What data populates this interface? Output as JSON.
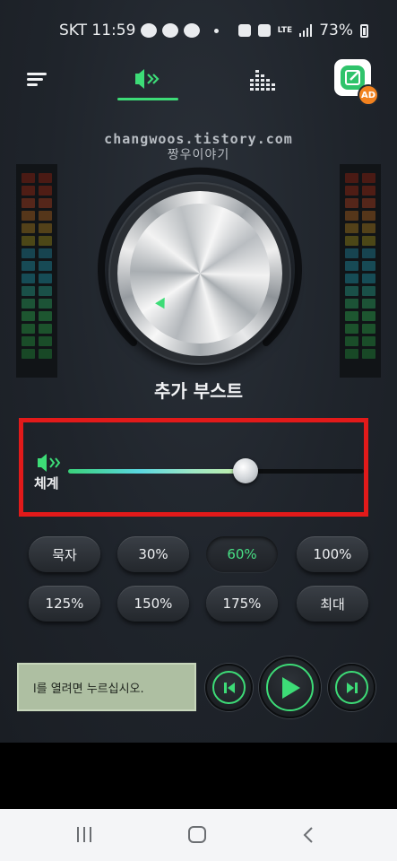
{
  "status_bar": {
    "carrier_time": "SKT 11:59",
    "lte": "LTE",
    "battery": "73%"
  },
  "nav": {
    "menu_icon": "hamburger-menu-icon",
    "volume_tab_icon": "speaker-boost-icon",
    "equalizer_tab_icon": "equalizer-bars-icon",
    "ad_badge": "AD"
  },
  "watermark": {
    "line1": "changwoos.tistory.com",
    "line2": "짱우이야기"
  },
  "knob": {
    "label": "추가 부스트",
    "indicator_icon": "triangle-indicator-icon"
  },
  "slider": {
    "label": "체계",
    "value_percent": 60,
    "accent": "#3ddc77"
  },
  "presets": [
    {
      "label": "묵자",
      "active": false
    },
    {
      "label": "30%",
      "active": false
    },
    {
      "label": "60%",
      "active": true
    },
    {
      "label": "100%",
      "active": false
    },
    {
      "label": "125%",
      "active": false
    },
    {
      "label": "150%",
      "active": false
    },
    {
      "label": "175%",
      "active": false
    },
    {
      "label": "최대",
      "active": false
    }
  ],
  "player": {
    "ticker_text": "l를 열려면 누르십시오.",
    "prev_icon": "skip-previous-icon",
    "play_icon": "play-icon",
    "next_icon": "skip-next-icon"
  },
  "colors": {
    "accent_green": "#3ddc77",
    "highlight_red": "#e21a1a",
    "ad_orange": "#f2821f"
  }
}
